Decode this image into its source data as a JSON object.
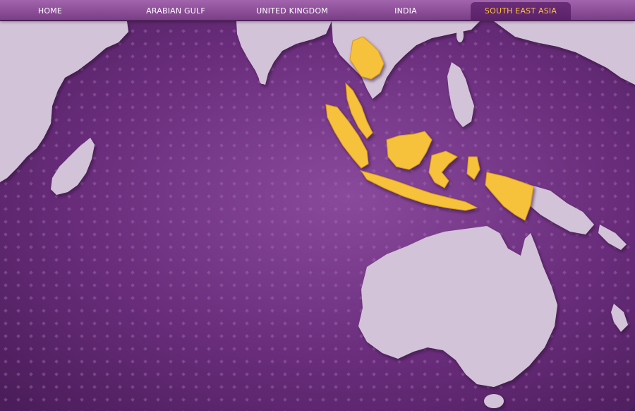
{
  "nav": {
    "items": [
      {
        "label": "HOME",
        "active": false
      },
      {
        "label": "ARABIAN GULF",
        "active": false
      },
      {
        "label": "UNITED KINGDOM",
        "active": false
      },
      {
        "label": "INDIA",
        "active": false
      },
      {
        "label": "SOUTH EAST ASIA",
        "active": true
      }
    ]
  },
  "map": {
    "highlighted_region": "South East Asia",
    "highlighted_countries": [
      "Thailand",
      "Malaysia",
      "Indonesia",
      "Borneo"
    ],
    "colors": {
      "background": "#6b2d7d",
      "land": "#d3c3d9",
      "highlight": "#f7c23b",
      "nav_active_text": "#ffc23a"
    }
  }
}
